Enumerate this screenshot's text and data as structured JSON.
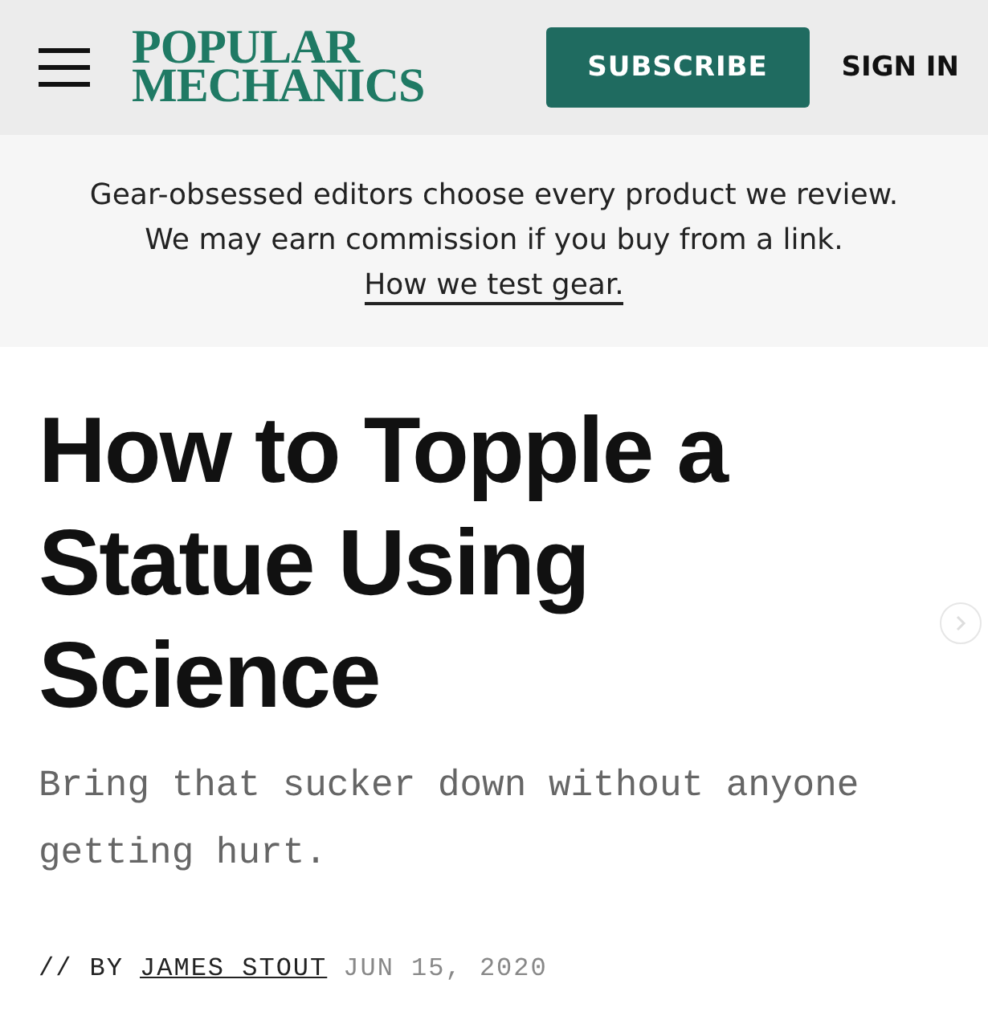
{
  "header": {
    "logo": [
      "POPULAR",
      "MECHANICS"
    ],
    "subscribe": "SUBSCRIBE",
    "sign_in": "SIGN IN"
  },
  "disclaimer": {
    "text": "Gear-obsessed editors choose every product we review. We may earn commission if you buy from a link.",
    "link": "How we test gear."
  },
  "article": {
    "title": "How to Topple a Statue Using Science",
    "dek": "Bring that sucker down without anyone getting hurt.",
    "byline_prefix": "// BY",
    "author": "JAMES STOUT",
    "date": "JUN 15, 2020"
  }
}
